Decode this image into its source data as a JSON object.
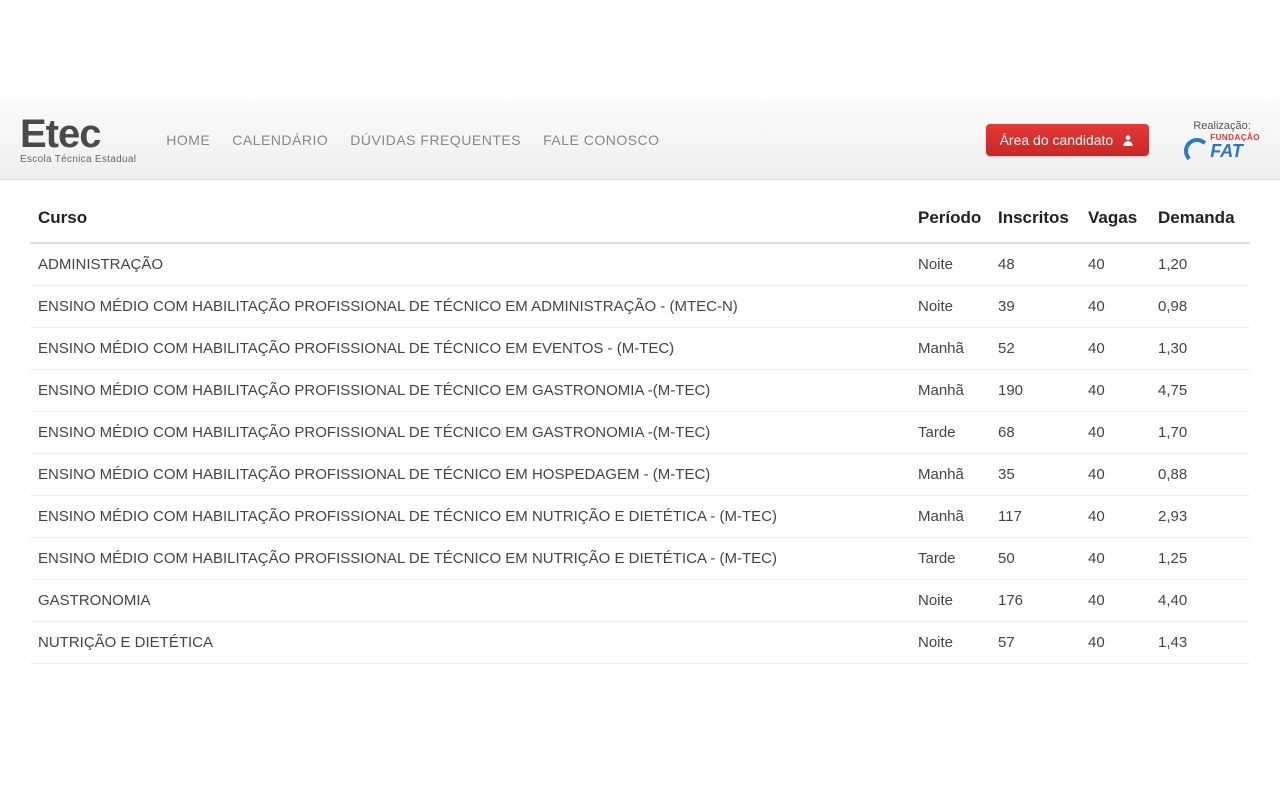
{
  "logo": {
    "main": "Etec",
    "sub": "Escola Técnica Estadual"
  },
  "nav": {
    "home": "HOME",
    "calendario": "CALENDÁRIO",
    "duvidas": "DÚVIDAS FREQUENTES",
    "fale": "FALE CONOSCO"
  },
  "candidate_button": "Área do candidato",
  "realizacao": {
    "label": "Realização:",
    "fund": "FUNDAÇÃO",
    "fat": "FAT"
  },
  "table": {
    "headers": {
      "curso": "Curso",
      "periodo": "Período",
      "inscritos": "Inscritos",
      "vagas": "Vagas",
      "demanda": "Demanda"
    },
    "rows": [
      {
        "curso": "ADMINISTRAÇÃO",
        "periodo": "Noite",
        "inscritos": "48",
        "vagas": "40",
        "demanda": "1,20"
      },
      {
        "curso": "ENSINO MÉDIO COM HABILITAÇÃO PROFISSIONAL DE TÉCNICO EM ADMINISTRAÇÃO - (MTEC-N)",
        "periodo": "Noite",
        "inscritos": "39",
        "vagas": "40",
        "demanda": "0,98"
      },
      {
        "curso": "ENSINO MÉDIO COM HABILITAÇÃO PROFISSIONAL DE TÉCNICO EM EVENTOS - (M-TEC)",
        "periodo": "Manhã",
        "inscritos": "52",
        "vagas": "40",
        "demanda": "1,30"
      },
      {
        "curso": "ENSINO MÉDIO COM HABILITAÇÃO PROFISSIONAL DE TÉCNICO EM GASTRONOMIA -(M-TEC)",
        "periodo": "Manhã",
        "inscritos": "190",
        "vagas": "40",
        "demanda": "4,75"
      },
      {
        "curso": "ENSINO MÉDIO COM HABILITAÇÃO PROFISSIONAL DE TÉCNICO EM GASTRONOMIA -(M-TEC)",
        "periodo": "Tarde",
        "inscritos": "68",
        "vagas": "40",
        "demanda": "1,70"
      },
      {
        "curso": "ENSINO MÉDIO COM HABILITAÇÃO PROFISSIONAL DE TÉCNICO EM HOSPEDAGEM - (M-TEC)",
        "periodo": "Manhã",
        "inscritos": "35",
        "vagas": "40",
        "demanda": "0,88"
      },
      {
        "curso": "ENSINO MÉDIO COM HABILITAÇÃO PROFISSIONAL DE TÉCNICO EM NUTRIÇÃO E DIETÉTICA - (M-TEC)",
        "periodo": "Manhã",
        "inscritos": "117",
        "vagas": "40",
        "demanda": "2,93"
      },
      {
        "curso": "ENSINO MÉDIO COM HABILITAÇÃO PROFISSIONAL DE TÉCNICO EM NUTRIÇÃO E DIETÉTICA - (M-TEC)",
        "periodo": "Tarde",
        "inscritos": "50",
        "vagas": "40",
        "demanda": "1,25"
      },
      {
        "curso": "GASTRONOMIA",
        "periodo": "Noite",
        "inscritos": "176",
        "vagas": "40",
        "demanda": "4,40"
      },
      {
        "curso": "NUTRIÇÃO E DIETÉTICA",
        "periodo": "Noite",
        "inscritos": "57",
        "vagas": "40",
        "demanda": "1,43"
      }
    ]
  }
}
